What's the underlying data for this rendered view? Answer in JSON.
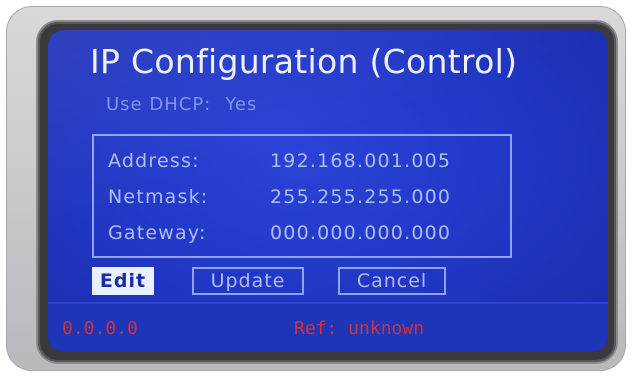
{
  "screen": {
    "title": "IP Configuration (Control)",
    "dhcp": {
      "label": "Use DHCP:",
      "value": "Yes"
    },
    "network": [
      {
        "label": "Address:",
        "value": "192.168.001.005"
      },
      {
        "label": "Netmask:",
        "value": "255.255.255.000"
      },
      {
        "label": "Gateway:",
        "value": "000.000.000.000"
      }
    ],
    "buttons": {
      "edit": "Edit",
      "update": "Update",
      "cancel": "Cancel",
      "selected": "edit"
    },
    "status": {
      "ip": "0.0.0.0",
      "ref": "Ref: unknown"
    }
  },
  "colors": {
    "background": "#2238c6",
    "title_text": "#eef0ff",
    "dim_text": "#7f90e8",
    "field_text": "#aebcff",
    "border": "#8fa3f5",
    "selected_button_bg": "#e9f1ff",
    "status_text": "#d2323c"
  }
}
